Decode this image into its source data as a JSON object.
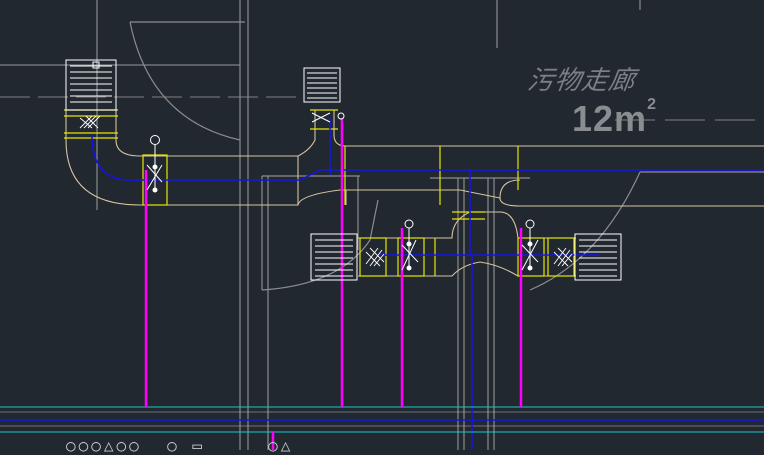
{
  "room": {
    "name": "污物走廊",
    "area_value": "12m",
    "area_unit_sup": "2"
  },
  "bottom_text": "○○○△○○  ○ ▭     ○△",
  "colors": {
    "background": "#212830",
    "wall": "#8c8c8c",
    "duct": "#d7c39e",
    "flange": "#e6e600",
    "pipe_blue": "#1414e6",
    "riser": "#ff00ff",
    "cyan": "#16c8c8",
    "grille": "#ffffff"
  }
}
